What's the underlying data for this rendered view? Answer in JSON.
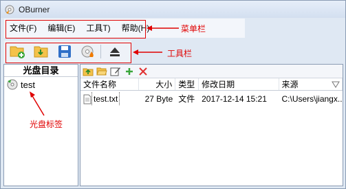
{
  "window": {
    "title": "OBurner"
  },
  "menubar": {
    "items": [
      {
        "label": "文件(F)"
      },
      {
        "label": "编辑(E)"
      },
      {
        "label": "工具T)"
      },
      {
        "label": "帮助(H)"
      }
    ],
    "annotation": "菜单栏"
  },
  "toolbar": {
    "buttons": [
      {
        "icon": "new-folder-icon"
      },
      {
        "icon": "import-icon"
      },
      {
        "icon": "save-icon"
      },
      {
        "icon": "burn-disc-icon"
      },
      {
        "icon": "eject-icon"
      }
    ],
    "annotation": "工具栏"
  },
  "left_panel": {
    "header": "光盘目录",
    "items": [
      {
        "label": "test",
        "icon": "disc-icon"
      }
    ],
    "annotation": "光盘标签"
  },
  "right_panel": {
    "toolbar_icons": [
      "up-folder-icon",
      "open-folder-icon",
      "edit-icon",
      "add-icon",
      "delete-icon"
    ],
    "columns": [
      "文件名称",
      "大小",
      "类型",
      "修改日期",
      "来源"
    ],
    "rows": [
      {
        "name": "test.txt",
        "size": "27 Byte",
        "type": "文件",
        "modified": "2017-12-14 15:21",
        "source": "C:\\Users\\jiangx..."
      }
    ]
  },
  "colors": {
    "annotation_red": "#e00000",
    "accent_green": "#3aa63a"
  }
}
